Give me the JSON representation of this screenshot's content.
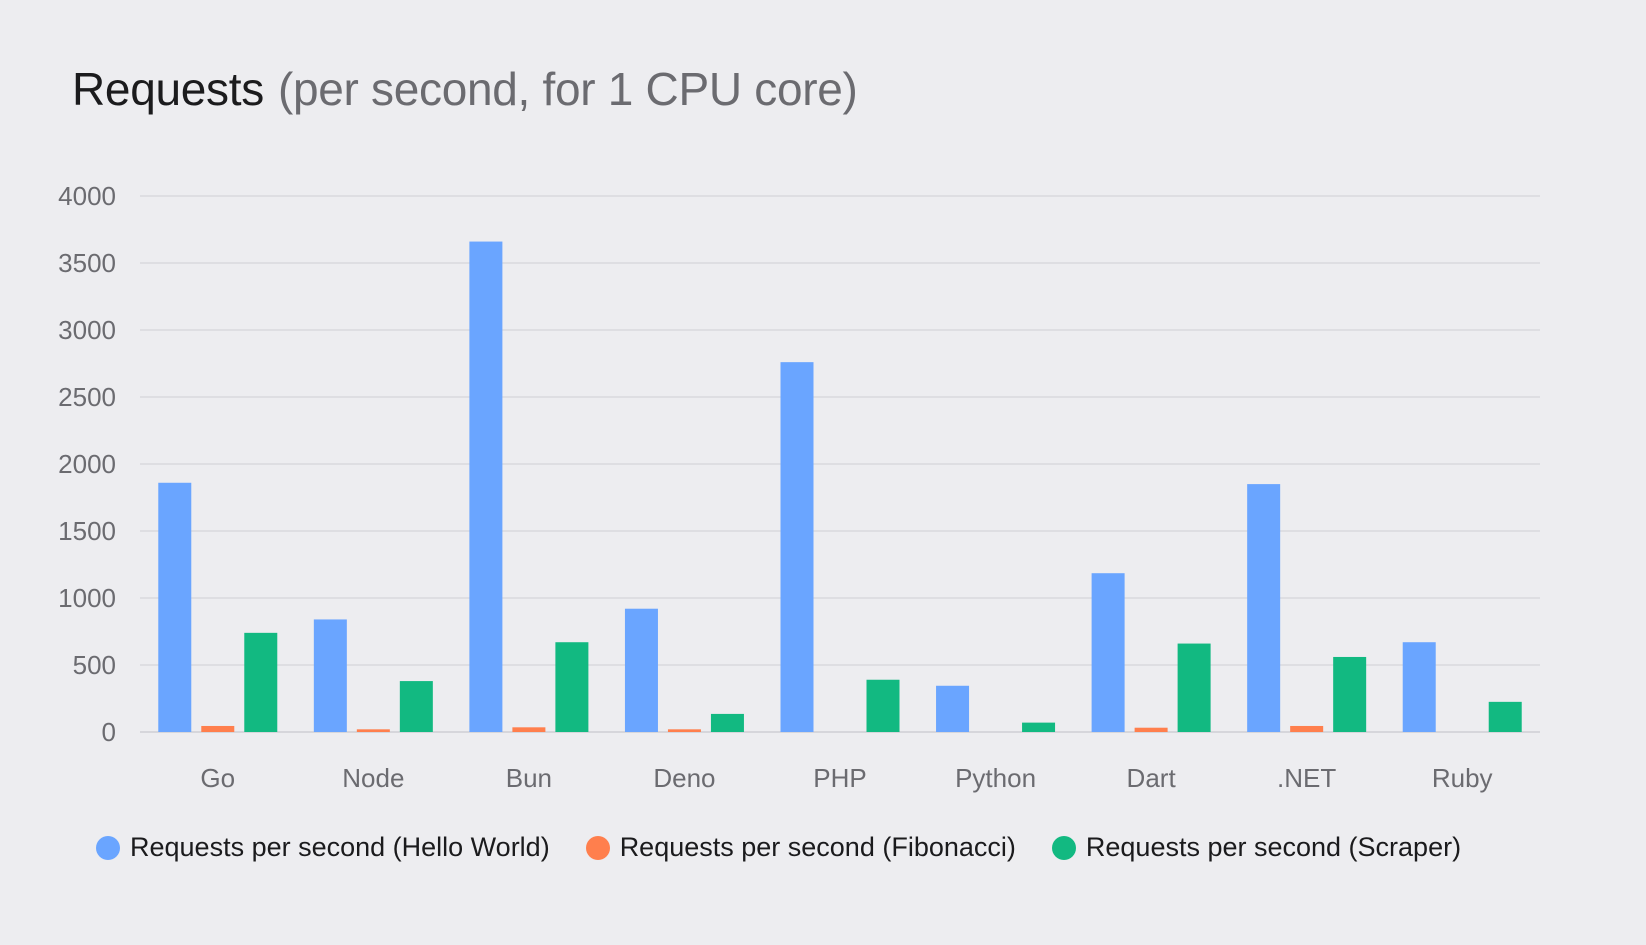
{
  "title": {
    "main": "Requests",
    "sub": "(per second, for 1 CPU core)"
  },
  "chart_data": {
    "type": "bar",
    "title": "Requests (per second, for 1 CPU core)",
    "xlabel": "",
    "ylabel": "",
    "categories": [
      "Go",
      "Node",
      "Bun",
      "Deno",
      "PHP",
      "Python",
      "Dart",
      ".NET",
      "Ruby"
    ],
    "ylim": [
      0,
      4000
    ],
    "yticks": [
      0,
      500,
      1000,
      1500,
      2000,
      2500,
      3000,
      3500,
      4000
    ],
    "grid": true,
    "legend_position": "bottom",
    "series": [
      {
        "name": "Requests per second (Hello World)",
        "color": "#6aa5ff",
        "values": [
          1860,
          840,
          3660,
          920,
          2760,
          345,
          1185,
          1850,
          670
        ]
      },
      {
        "name": "Requests per second (Fibonacci)",
        "color": "#ff7f4d",
        "values": [
          45,
          20,
          35,
          20,
          0,
          0,
          32,
          45,
          0
        ]
      },
      {
        "name": "Requests per second (Scraper)",
        "color": "#12b981",
        "values": [
          740,
          380,
          670,
          135,
          390,
          70,
          660,
          560,
          225
        ]
      }
    ]
  }
}
